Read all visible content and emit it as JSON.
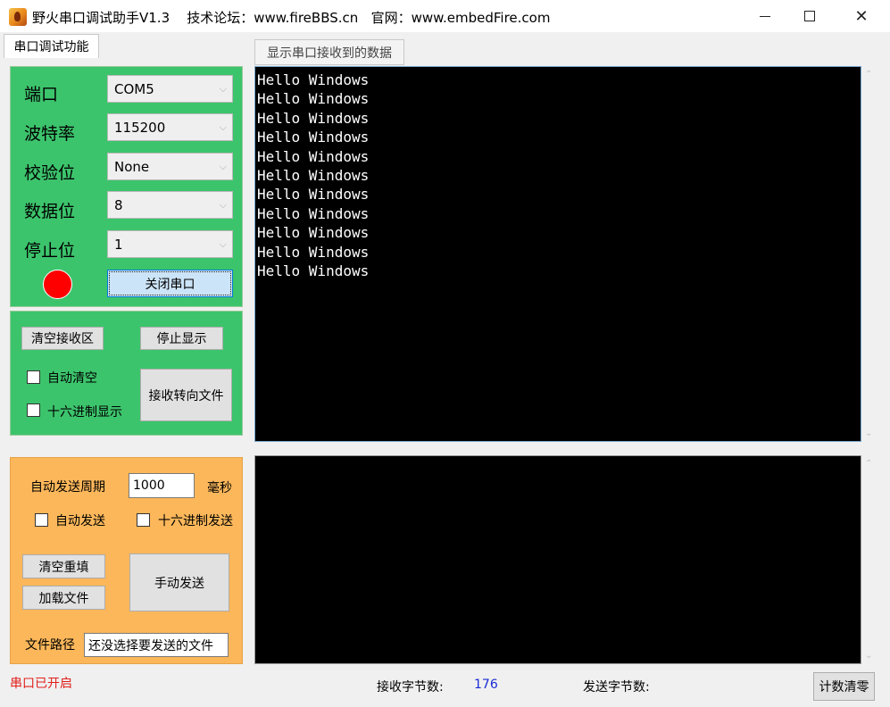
{
  "window": {
    "title": "野火串口调试助手V1.3    技术论坛：www.fireBBS.cn   官网：www.embedFire.com",
    "close_glyph": "✕"
  },
  "tab": {
    "label": "串口调试功能"
  },
  "tooltip": {
    "text": "显示串口接收到的数据"
  },
  "serial": {
    "port_label": "端口",
    "port_value": "COM5",
    "baud_label": "波特率",
    "baud_value": "115200",
    "parity_label": "校验位",
    "parity_value": "None",
    "databits_label": "数据位",
    "databits_value": "8",
    "stopbits_label": "停止位",
    "stopbits_value": "1",
    "close_port_label": "关闭串口",
    "led_color": "#ff0000"
  },
  "recv_controls": {
    "clear_label": "清空接收区",
    "stop_display_label": "停止显示",
    "auto_clear_label": "自动清空",
    "hex_display_label": "十六进制显示",
    "redirect_label": "接收转向文件"
  },
  "recv_lines": [
    "Hello Windows",
    "Hello Windows",
    "Hello Windows",
    "Hello Windows",
    "Hello Windows",
    "Hello Windows",
    "Hello Windows",
    "Hello Windows",
    "Hello Windows",
    "Hello Windows",
    "Hello Windows"
  ],
  "send_controls": {
    "period_label": "自动发送周期",
    "period_value": "1000",
    "unit_label": "毫秒",
    "auto_send_label": "自动发送",
    "hex_send_label": "十六进制发送",
    "clear_refill_label": "清空重填",
    "load_file_label": "加载文件",
    "manual_send_label": "手动发送",
    "file_path_label": "文件路径",
    "file_path_value": "还没选择要发送的文件"
  },
  "status": {
    "port_status": "串口已开启",
    "recv_bytes_label": "接收字节数:",
    "recv_bytes_value": "176",
    "send_bytes_label": "发送字节数:",
    "send_bytes_value": "",
    "reset_label": "计数清零"
  },
  "colors": {
    "serial_panel": "#3cc46c",
    "send_panel": "#fbb75a",
    "status_text": "#e0201c",
    "recv_count": "#1a2bd6"
  },
  "icons": {
    "app": "app-logo-icon",
    "minimize": "minimize-icon",
    "maximize": "maximize-icon",
    "close": "close-icon",
    "combo": "chevron-down-icon"
  }
}
